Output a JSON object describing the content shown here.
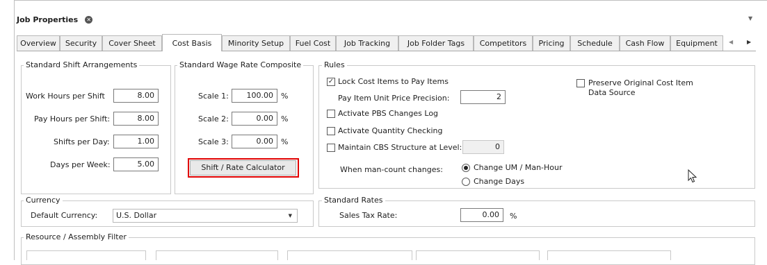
{
  "panel": {
    "title": "Job Properties",
    "close_icon": "close-circle-icon",
    "dropdown_icon": "chevron-down-icon"
  },
  "tabs": [
    {
      "label": "Overview",
      "active": false
    },
    {
      "label": "Security",
      "active": false
    },
    {
      "label": "Cover Sheet",
      "active": false
    },
    {
      "label": "Cost Basis",
      "active": true
    },
    {
      "label": "Minority Setup",
      "active": false
    },
    {
      "label": "Fuel Cost",
      "active": false
    },
    {
      "label": "Job Tracking",
      "active": false
    },
    {
      "label": "Job Folder Tags",
      "active": false
    },
    {
      "label": "Competitors",
      "active": false
    },
    {
      "label": "Pricing",
      "active": false
    },
    {
      "label": "Schedule",
      "active": false
    },
    {
      "label": "Cash Flow",
      "active": false
    },
    {
      "label": "Equipment",
      "active": false
    }
  ],
  "tab_nav": {
    "prev_icon": "chevron-left-icon",
    "next_icon": "chevron-right-icon"
  },
  "shift": {
    "title": "Standard Shift Arrangements",
    "work_hours_label": "Work Hours per Shift",
    "work_hours": "8.00",
    "pay_hours_label": "Pay Hours per Shift:",
    "pay_hours": "8.00",
    "shifts_day_label": "Shifts per Day:",
    "shifts_day": "1.00",
    "days_week_label": "Days per Week:",
    "days_week": "5.00"
  },
  "wage": {
    "title": "Standard Wage Rate Composite",
    "scale1_label": "Scale 1:",
    "scale1": "100.00",
    "scale2_label": "Scale 2:",
    "scale2": "0.00",
    "scale3_label": "Scale 3:",
    "scale3": "0.00",
    "percent": "%",
    "calc_button": "Shift / Rate Calculator"
  },
  "rules": {
    "title": "Rules",
    "lock_label": "Lock Cost Items to Pay Items",
    "lock_checked": true,
    "precision_label": "Pay Item Unit Price Precision:",
    "precision": "2",
    "pbs_label": "Activate PBS Changes Log",
    "qty_label": "Activate Quantity Checking",
    "cbs_label": "Maintain CBS Structure at Level:",
    "cbs_level": "0",
    "mancount_label": "When man-count changes:",
    "radio_um": "Change UM / Man-Hour",
    "radio_days": "Change Days",
    "preserve_label": "Preserve Original Cost Item",
    "preserve_label2": "Data Source"
  },
  "currency": {
    "title": "Currency",
    "default_label": "Default Currency:",
    "value": "U.S. Dollar"
  },
  "standard_rates": {
    "title": "Standard Rates",
    "tax_label": "Sales Tax Rate:",
    "tax_value": "0.00",
    "percent": "%"
  },
  "filter": {
    "title": "Resource / Assembly Filter"
  },
  "colors": {
    "highlight": "#e00000",
    "border": "#c9c9c9"
  }
}
